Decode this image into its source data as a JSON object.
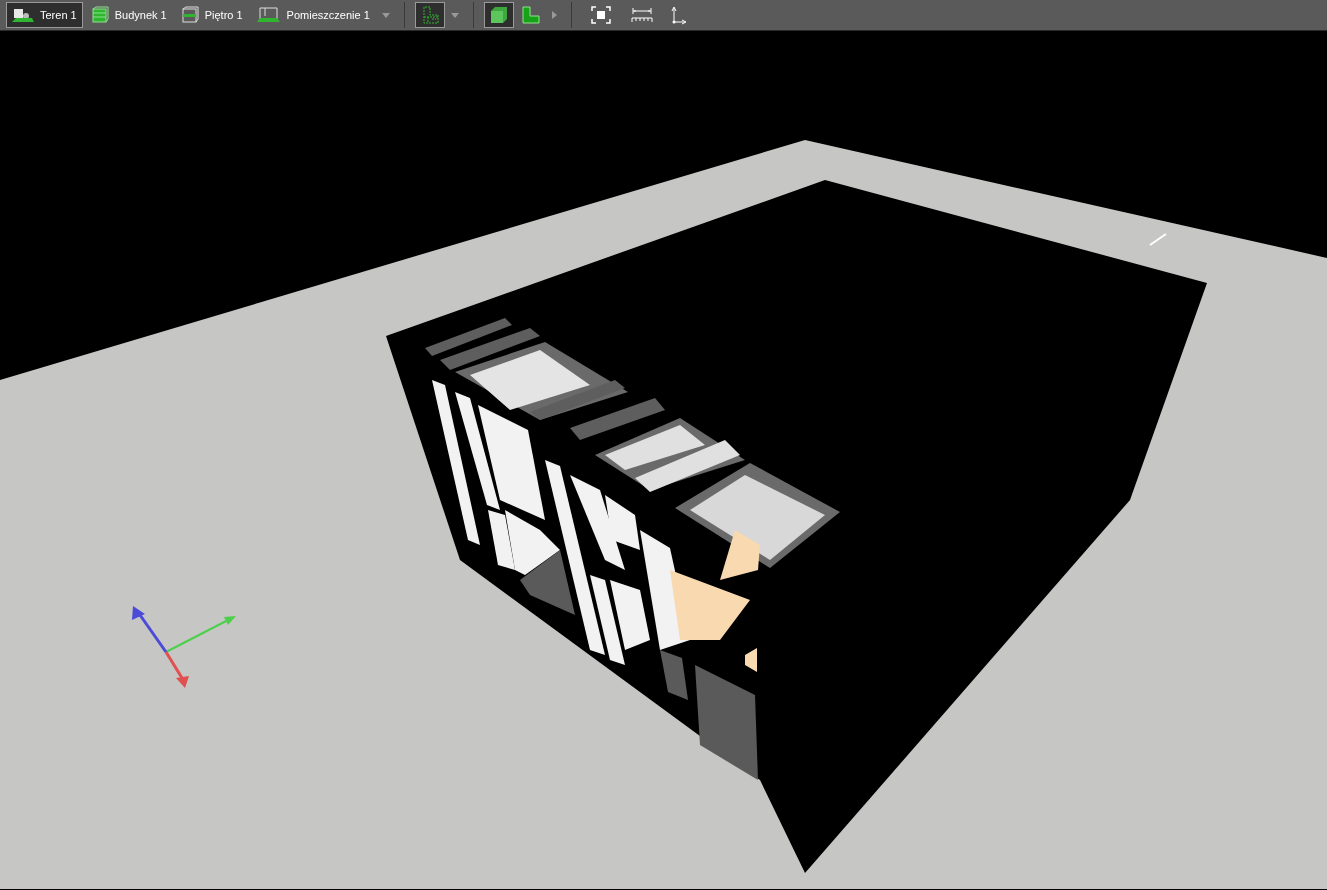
{
  "toolbar": {
    "breadcrumbs": [
      {
        "label": "Teren 1",
        "kind": "terrain",
        "selected": true
      },
      {
        "label": "Budynek 1",
        "kind": "building",
        "selected": false
      },
      {
        "label": "Piętro 1",
        "kind": "floor",
        "selected": false
      },
      {
        "label": "Pomieszczenie 1",
        "kind": "room",
        "selected": false
      }
    ],
    "tools": [
      {
        "kind": "plan",
        "selected": true
      },
      {
        "kind": "cube",
        "selected": true
      },
      {
        "kind": "wall",
        "selected": false
      },
      {
        "kind": "fit",
        "selected": false
      },
      {
        "kind": "measure",
        "selected": false
      },
      {
        "kind": "axes",
        "selected": false
      }
    ]
  }
}
